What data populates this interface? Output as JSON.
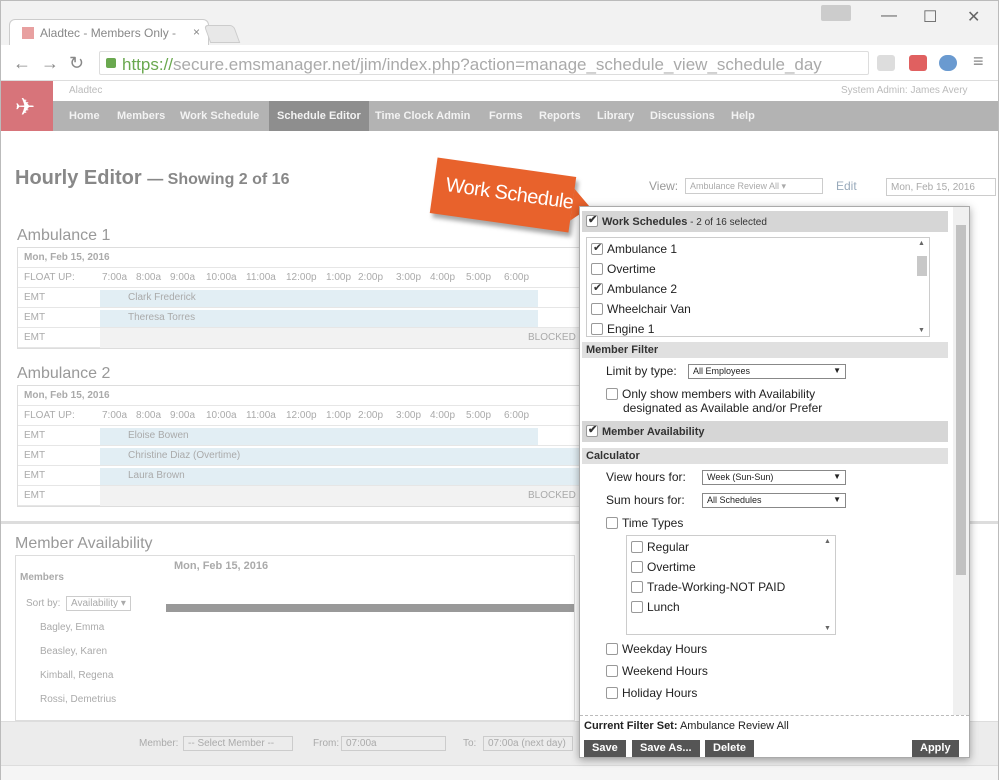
{
  "browser": {
    "tab_title": "Aladtec - Members Only -",
    "url_scheme": "https://",
    "url_rest": "secure.emsmanager.net/jim/index.php?action=manage_schedule_view_schedule_day"
  },
  "header": {
    "org_name": "Aladtec",
    "user": "System Admin: James Avery",
    "menu": [
      "Home",
      "Members",
      "Work Schedule",
      "Schedule Editor",
      "Time Clock Admin",
      "Forms",
      "Reports",
      "Library",
      "Discussions",
      "Help"
    ],
    "active_menu": "Schedule Editor"
  },
  "page": {
    "title": "Hourly Editor",
    "subtitle": "— Showing 2 of 16",
    "view_label": "View:",
    "view_value": "Ambulance Review All",
    "edit_link": "Edit",
    "date_value": "Mon, Feb 15, 2016"
  },
  "schedules": [
    {
      "name": "Ambulance 1",
      "date": "Mon, Feb 15, 2016",
      "float_label": "FLOAT UP:",
      "rows": [
        {
          "pos": "EMT",
          "member": "Clark Frederick"
        },
        {
          "pos": "EMT",
          "member": "Theresa Torres"
        },
        {
          "pos": "EMT",
          "member": ""
        }
      ],
      "blocked_label": "BLOCKED"
    },
    {
      "name": "Ambulance 2",
      "date": "Mon, Feb 15, 2016",
      "float_label": "FLOAT UP:",
      "rows": [
        {
          "pos": "EMT",
          "member": "Eloise Bowen"
        },
        {
          "pos": "EMT",
          "member": "Christine Diaz (Overtime)"
        },
        {
          "pos": "EMT",
          "member": "Laura Brown"
        },
        {
          "pos": "EMT",
          "member": ""
        }
      ],
      "blocked_label": "BLOCKED"
    }
  ],
  "hours": [
    "7:00a",
    "8:00a",
    "9:00a",
    "10:00a",
    "11:00a",
    "12:00p",
    "1:00p",
    "2:00p",
    "3:00p",
    "4:00p",
    "5:00p",
    "6:00p"
  ],
  "availability": {
    "title": "Member Availability",
    "members_label": "Members",
    "date": "Mon, Feb 15, 2016",
    "sort_label": "Sort by:",
    "sort_value": "Availability",
    "members": [
      "Bagley, Emma",
      "Beasley, Karen",
      "Kimball, Regena",
      "Rossi, Demetrius"
    ]
  },
  "bottom": {
    "member_label": "Member:",
    "member_value": "-- Select Member --",
    "from_label": "From:",
    "from_value": "07:00a",
    "to_label": "To:",
    "to_value": "07:00a (next day)"
  },
  "callout": {
    "text": "Work Schedule"
  },
  "filter": {
    "work_schedules_title": "Work Schedules",
    "work_schedules_count": " - 2 of 16 selected",
    "schedule_items": [
      {
        "label": "Ambulance 1",
        "checked": true
      },
      {
        "label": "Overtime",
        "checked": false
      },
      {
        "label": "Ambulance 2",
        "checked": true
      },
      {
        "label": "Wheelchair Van",
        "checked": false
      },
      {
        "label": "Engine 1",
        "checked": false
      }
    ],
    "member_filter_title": "Member Filter",
    "limit_label": "Limit by type:",
    "limit_value": "All Employees",
    "only_show_line1": "Only show members with Availability",
    "only_show_line2": "designated as Available and/or Prefer",
    "member_availability_title": "Member Availability",
    "calculator_title": "Calculator",
    "view_hours_label": "View hours for:",
    "view_hours_value": "Week (Sun-Sun)",
    "sum_hours_label": "Sum hours for:",
    "sum_hours_value": "All Schedules",
    "time_types_label": "Time Types",
    "time_types": [
      "Regular",
      "Overtime",
      "Trade-Working-NOT PAID",
      "Lunch"
    ],
    "weekday_label": "Weekday Hours",
    "weekend_label": "Weekend Hours",
    "holiday_label": "Holiday Hours",
    "current_set_label": "Current Filter Set:",
    "current_set_value": "Ambulance Review All",
    "save": "Save",
    "save_as": "Save As...",
    "delete": "Delete",
    "apply": "Apply"
  },
  "colors": {
    "accent_orange": "#e8622c",
    "menu_gray": "#b3b3b3",
    "logo_pink": "#d7747a"
  }
}
